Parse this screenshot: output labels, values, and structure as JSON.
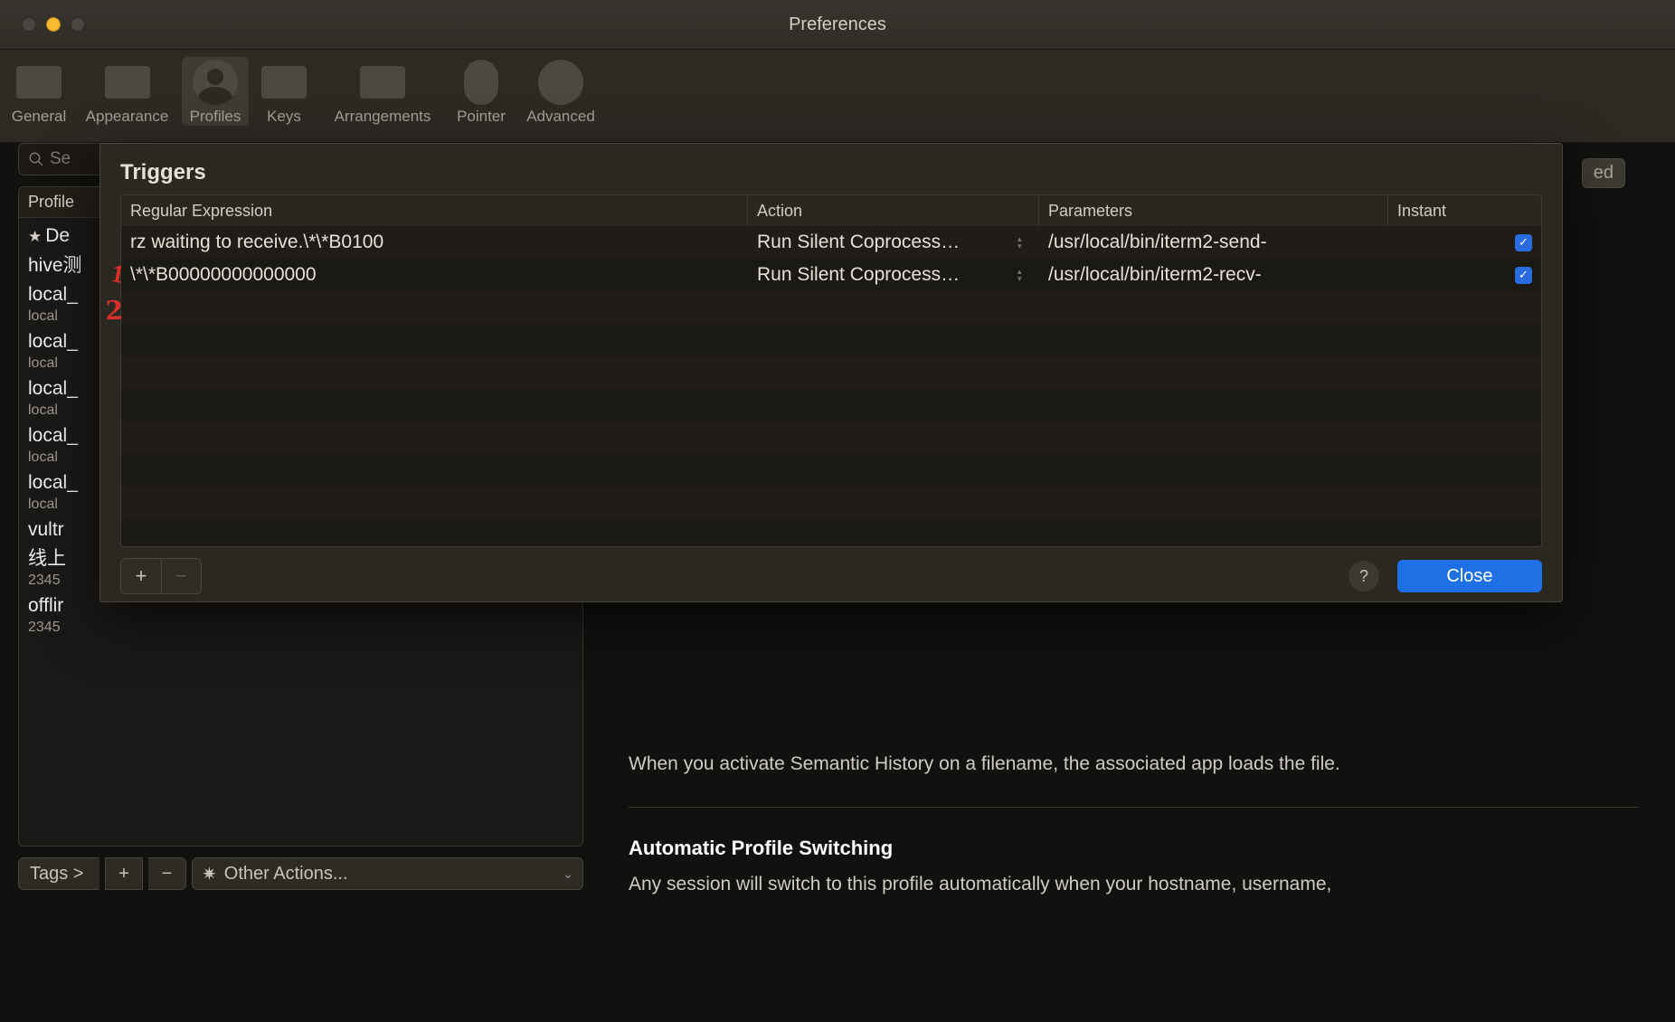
{
  "window": {
    "title": "Preferences"
  },
  "toolbar": {
    "items": [
      {
        "label": "General"
      },
      {
        "label": "Appearance"
      },
      {
        "label": "Profiles"
      },
      {
        "label": "Keys"
      },
      {
        "label": "Arrangements"
      },
      {
        "label": "Pointer"
      },
      {
        "label": "Advanced"
      }
    ],
    "selected": "Profiles"
  },
  "sidebar": {
    "search_placeholder": "Se",
    "header": "Profile",
    "profiles": [
      {
        "name": "De",
        "sub": "",
        "star": true
      },
      {
        "name": "hive测",
        "sub": ""
      },
      {
        "name": "local_",
        "sub": "local"
      },
      {
        "name": "local_",
        "sub": "local"
      },
      {
        "name": "local_",
        "sub": "local"
      },
      {
        "name": "local_",
        "sub": "local"
      },
      {
        "name": "local_",
        "sub": "local"
      },
      {
        "name": "vultr",
        "sub": ""
      },
      {
        "name": "线上",
        "sub": "2345"
      },
      {
        "name": "offlir",
        "sub": "2345"
      }
    ],
    "footer": {
      "tags_label": "Tags >",
      "other_label": "Other Actions..."
    }
  },
  "right_content": {
    "semantic_hint": "When you activate Semantic History on a filename, the associated app loads the file.",
    "aps_title": "Automatic Profile Switching",
    "aps_text": "Any session will switch to this profile automatically when your hostname, username,"
  },
  "ed_badge": "ed",
  "dialog": {
    "title": "Triggers",
    "columns": {
      "re": "Regular Expression",
      "action": "Action",
      "params": "Parameters",
      "instant": "Instant"
    },
    "rows": [
      {
        "re": "rz waiting to receive.\\*\\*B0100",
        "action": "Run Silent Coprocess…",
        "params": "/usr/local/bin/iterm2-send-",
        "instant": true
      },
      {
        "re": "\\*\\*B00000000000000",
        "action": "Run Silent Coprocess…",
        "params": "/usr/local/bin/iterm2-recv-",
        "instant": true
      }
    ],
    "close": "Close"
  },
  "annotations": {
    "a1": "1",
    "a2": "2"
  }
}
